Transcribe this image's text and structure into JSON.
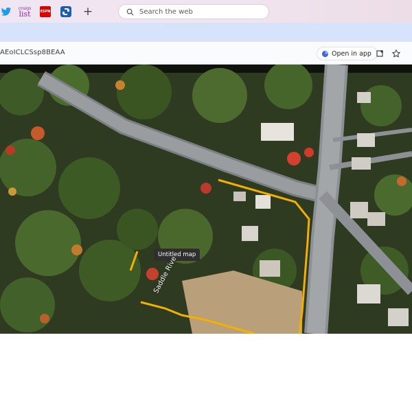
{
  "browser": {
    "bookmarks": [
      {
        "name": "twitter-icon",
        "color": "#1d9bf0"
      },
      {
        "name": "craigslist-icon",
        "text": "craigs list",
        "color": "#8a2a9d"
      },
      {
        "name": "espn-icon",
        "text": "ESPN",
        "color": "#d00"
      },
      {
        "name": "chase-icon",
        "color": "#1a5fb4"
      },
      {
        "name": "add-tab-icon",
        "text": "+"
      }
    ],
    "search_placeholder": "Search the web"
  },
  "address_bar": {
    "url_fragment": "AEoICLCSsp8BEAA",
    "open_in_app_label": "Open in app"
  },
  "map": {
    "tooltip": "Untitled map",
    "road_label": "Saddle Rive",
    "boundary_color": "#f4b000"
  }
}
